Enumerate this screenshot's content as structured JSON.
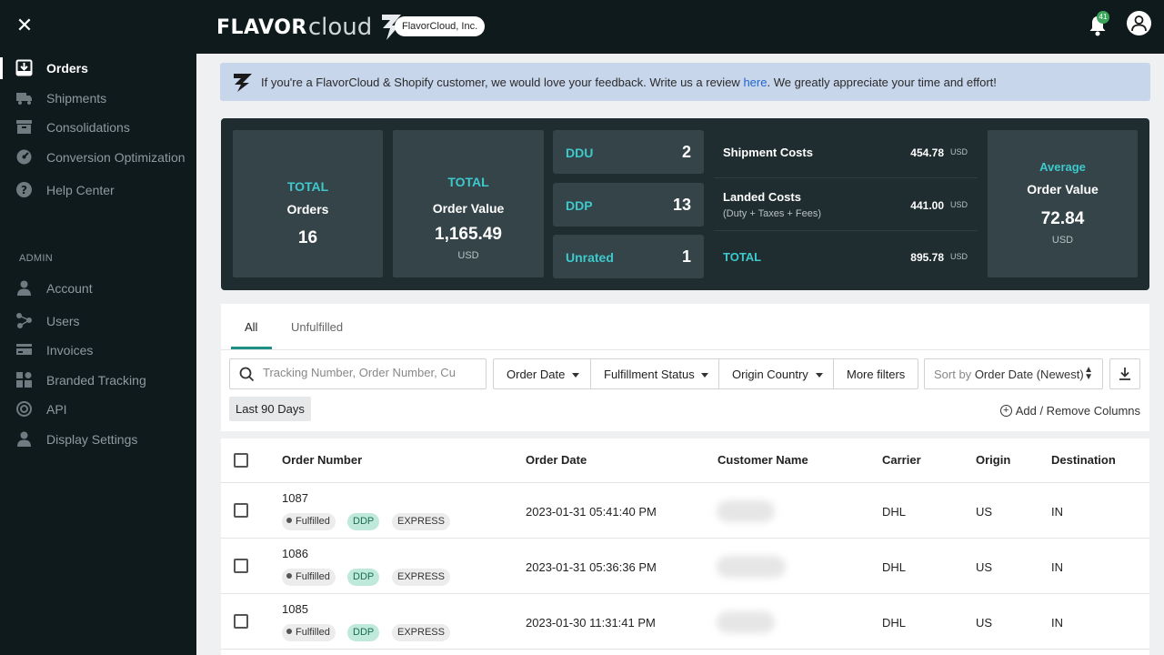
{
  "app": {
    "logo_bold": "FLAVOR",
    "logo_light": "cloud",
    "company": "FlavorCloud, Inc.",
    "notification_count": "41"
  },
  "sidebar": {
    "items": [
      {
        "label": "Orders",
        "icon": "orders-icon",
        "active": true
      },
      {
        "label": "Shipments",
        "icon": "truck-icon"
      },
      {
        "label": "Consolidations",
        "icon": "box-icon"
      },
      {
        "label": "Conversion Optimization",
        "icon": "gauge-icon"
      },
      {
        "label": "Help Center",
        "icon": "help-icon"
      }
    ],
    "admin_label": "ADMIN",
    "admin_items": [
      {
        "label": "Account",
        "icon": "account-icon"
      },
      {
        "label": "Users",
        "icon": "users-icon"
      },
      {
        "label": "Invoices",
        "icon": "invoices-icon"
      },
      {
        "label": "Branded Tracking",
        "icon": "branded-tracking-icon"
      },
      {
        "label": "API",
        "icon": "api-icon"
      },
      {
        "label": "Display Settings",
        "icon": "display-settings-icon"
      }
    ]
  },
  "banner": {
    "text_before": "If you're a FlavorCloud & Shopify customer, we would love your feedback. Write us a review ",
    "link": "here",
    "text_after": ". We greatly appreciate your time and effort!"
  },
  "summary": {
    "total_orders": {
      "top": "TOTAL",
      "label": "Orders",
      "value": "16"
    },
    "total_value": {
      "top": "TOTAL",
      "label": "Order Value",
      "value": "1,165.49",
      "currency": "USD"
    },
    "ddu": {
      "label": "DDU",
      "value": "2"
    },
    "ddp": {
      "label": "DDP",
      "value": "13"
    },
    "unrated": {
      "label": "Unrated",
      "value": "1"
    },
    "costs": [
      {
        "label": "Shipment Costs",
        "sub": "",
        "value": "454.78",
        "currency": "USD"
      },
      {
        "label": "Landed Costs",
        "sub": "(Duty + Taxes + Fees)",
        "value": "441.00",
        "currency": "USD"
      },
      {
        "label": "TOTAL",
        "sub": "",
        "value": "895.78",
        "currency": "USD"
      }
    ],
    "average": {
      "top": "Average",
      "label": "Order Value",
      "value": "72.84",
      "currency": "USD"
    }
  },
  "tabs": {
    "all": "All",
    "unfulfilled": "Unfulfilled"
  },
  "filters": {
    "search_placeholder": "Tracking Number, Order Number, Cu",
    "order_date": "Order Date",
    "fulfillment_status": "Fulfillment Status",
    "origin_country": "Origin Country",
    "more_filters": "More filters",
    "sort_prefix": "Sort by",
    "sort_value": "Order Date (Newest)",
    "date_chip": "Last 90 Days",
    "add_remove_columns": "Add / Remove Columns"
  },
  "table": {
    "headers": {
      "order_number": "Order Number",
      "order_date": "Order Date",
      "customer_name": "Customer Name",
      "carrier": "Carrier",
      "origin": "Origin",
      "destination": "Destination"
    },
    "rows": [
      {
        "order_number": "1087",
        "status": "Fulfilled",
        "duty": "DDP",
        "service": "EXPRESS",
        "date": "2023-01-31 05:41:40 PM",
        "carrier": "DHL",
        "origin": "US",
        "destination": "IN"
      },
      {
        "order_number": "1086",
        "status": "Fulfilled",
        "duty": "DDP",
        "service": "EXPRESS",
        "date": "2023-01-31 05:36:36 PM",
        "carrier": "DHL",
        "origin": "US",
        "destination": "IN"
      },
      {
        "order_number": "1085",
        "status": "Fulfilled",
        "duty": "DDP",
        "service": "EXPRESS",
        "date": "2023-01-30 11:31:41 PM",
        "carrier": "DHL",
        "origin": "US",
        "destination": "IN"
      }
    ]
  },
  "colors": {
    "sidebar_bg": "#0f1a1d",
    "accent_teal": "#3ec9cc",
    "banner_bg": "#c8d6ec",
    "ddp_pill": "#bfe9da"
  }
}
